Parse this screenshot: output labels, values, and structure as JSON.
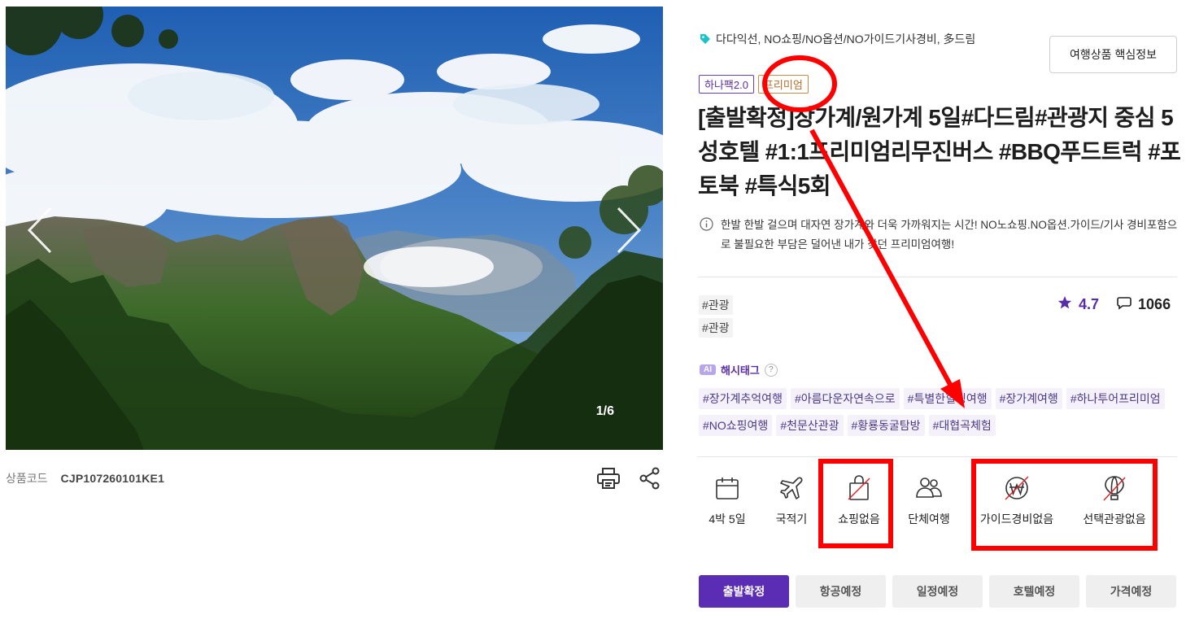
{
  "hero": {
    "counter": "1/6"
  },
  "product": {
    "code_label": "상품코드",
    "code_value": "CJP107260101KE1"
  },
  "header": {
    "tagline": "다다익선, NO쇼핑/NO옵션/NO가이드기사경비, 多드림",
    "key_info_button": "여행상품 핵심정보"
  },
  "badges": [
    "하나팩2.0",
    "프리미엄"
  ],
  "title": "[출발확정]장가계/원가계 5일#다드림#관광지 중심 5성호텔 #1:1프리미엄리무진버스 #BBQ푸드트럭 #포토북 #특식5회",
  "description": "한발 한발 걸으며 대자연 장가계와 더욱 가까워지는 시간! NO노쇼핑.NO옵션.가이드/기사 경비포함으로 불필요한 부담은 덜어낸 내가 찾던 프리미엄여행!",
  "category_tags": [
    "#관광",
    "#관광"
  ],
  "rating": {
    "score": "4.7",
    "reviews": "1066"
  },
  "ai": {
    "badge": "AI",
    "label": "해시태그",
    "help": "?"
  },
  "hashtags": [
    "#장가계추억여행",
    "#아름다운자연속으로",
    "#특별한힐링여행",
    "#장가계여행",
    "#하나투어프리미엄",
    "#NO쇼핑여행",
    "#천문산관광",
    "#황룡동굴탐방",
    "#대협곡체험"
  ],
  "features": [
    {
      "label": "4박 5일",
      "icon": "calendar-icon"
    },
    {
      "label": "국적기",
      "icon": "airplane-icon"
    },
    {
      "label": "쇼핑없음",
      "icon": "no-shopping-icon"
    },
    {
      "label": "단체여행",
      "icon": "group-icon"
    },
    {
      "label": "가이드경비없음",
      "icon": "no-guide-fee-icon"
    },
    {
      "label": "선택관광없음",
      "icon": "no-optional-tour-icon"
    }
  ],
  "tabs": [
    "출발확정",
    "항공예정",
    "일정예정",
    "호텔예정",
    "가격예정"
  ],
  "colors": {
    "accent": "#5a2db4",
    "annotation": "#ff0000"
  }
}
